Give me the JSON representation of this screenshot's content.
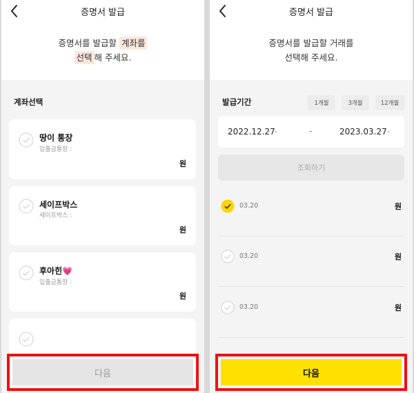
{
  "left": {
    "header": {
      "title": "증명서 발급"
    },
    "intro": {
      "line1_prefix": "증명서를 발급할 ",
      "line1_highlight": "계좌를",
      "line2_highlight": "선택",
      "line2_suffix": "해 주세요."
    },
    "section_title": "계좌선택",
    "accounts": [
      {
        "name": "땅이 통장",
        "sub": "입출금통장 :",
        "amount": "원"
      },
      {
        "name": "세이프박스",
        "sub": "세이프박스 :",
        "amount": "원"
      },
      {
        "name": "후아힌💗",
        "sub": "입출금통장 :",
        "amount": "원"
      },
      {
        "name": "",
        "sub": "",
        "amount": ""
      }
    ],
    "next_button": "다음"
  },
  "right": {
    "header": {
      "title": "증명서 발급"
    },
    "intro": {
      "line1": "증명서를 발급할 거래를",
      "line2": "선택해 주세요."
    },
    "period_label": "발급기간",
    "period_chips": [
      "1개월",
      "3개월",
      "12개월"
    ],
    "date_from": "2022.12.27",
    "date_to": "2023.03.27",
    "date_separator": "-",
    "query_button": "조회하기",
    "transactions": [
      {
        "date": "03.20",
        "amount": "원",
        "checked": true
      },
      {
        "date": "03.20",
        "amount": "원",
        "checked": false
      },
      {
        "date": "03.20",
        "amount": "원",
        "checked": false
      }
    ],
    "next_button": "다음"
  },
  "colors": {
    "accent_yellow": "#ffe100",
    "highlight_red": "#ee1111",
    "highlight_bg": "#fde6dc"
  }
}
